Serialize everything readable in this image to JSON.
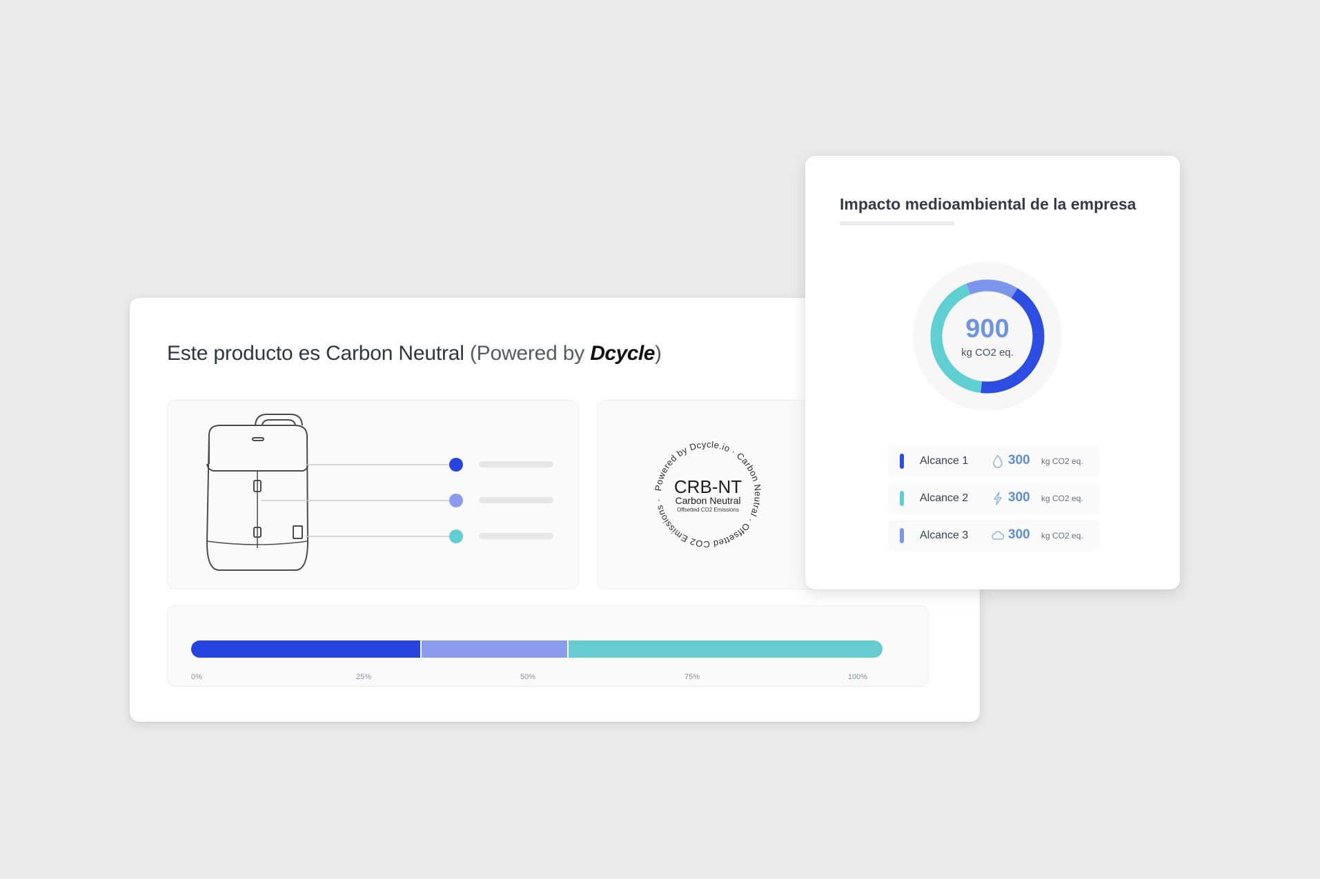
{
  "product_card": {
    "title": "Este producto es Carbon Neutral",
    "powered_prefix": "(Powered by ",
    "brand": "Dcycle",
    "powered_suffix": ")",
    "seal": {
      "ring_text": "Powered by Dcycle.io · Carbon Neutral · Offsetted CO2 Emissions ·",
      "code": "CRB-NT",
      "headline": "Carbon Neutral",
      "subline": "Offsetted CO2 Emissions"
    },
    "legend_dots": [
      {
        "color": "#2744e0"
      },
      {
        "color": "#8b9cec"
      },
      {
        "color": "#5fcfd2"
      }
    ],
    "progress": {
      "segments": [
        {
          "share": 0.333,
          "color": "#2744e0"
        },
        {
          "share": 0.213,
          "color": "#8b9cec"
        },
        {
          "share": 0.454,
          "color": "#66ccd2"
        }
      ],
      "ticks": [
        "0%",
        "25%",
        "50%",
        "75%",
        "100%"
      ]
    }
  },
  "impact_card": {
    "title": "Impacto medioambiental de la empresa",
    "total": "900",
    "total_unit": "kg CO2 eq.",
    "donut_segments": [
      {
        "share": 0.15,
        "color": "#7e95ee"
      },
      {
        "share": 0.43,
        "color": "#2c4ce2"
      },
      {
        "share": 0.42,
        "color": "#5fcfd2"
      }
    ],
    "scopes": [
      {
        "label": "Alcance 1",
        "value": "300",
        "unit": "kg CO2 eq.",
        "marker_color": "#2c4ce2",
        "icon": "drop-icon"
      },
      {
        "label": "Alcance 2",
        "value": "300",
        "unit": "kg CO2 eq.",
        "marker_color": "#5fcfd2",
        "icon": "lightning-icon"
      },
      {
        "label": "Alcance 3",
        "value": "300",
        "unit": "kg CO2 eq.",
        "marker_color": "#7e95ee",
        "icon": "cloud-icon"
      }
    ]
  }
}
